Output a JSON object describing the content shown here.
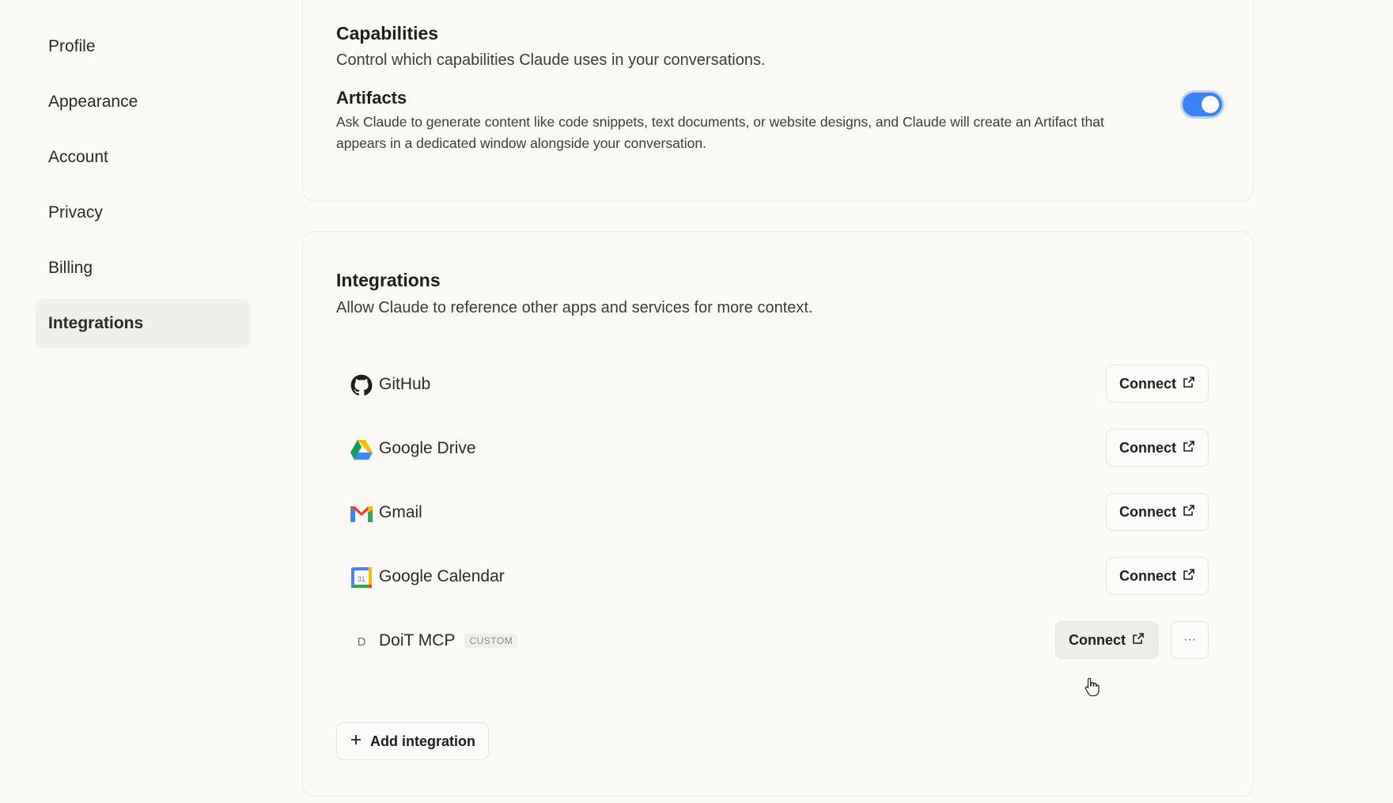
{
  "sidebar": {
    "items": [
      {
        "label": "Profile"
      },
      {
        "label": "Appearance"
      },
      {
        "label": "Account"
      },
      {
        "label": "Privacy"
      },
      {
        "label": "Billing"
      },
      {
        "label": "Integrations",
        "active": true
      }
    ]
  },
  "capabilities": {
    "title": "Capabilities",
    "description": "Control which capabilities Claude uses in your conversations.",
    "artifacts": {
      "title": "Artifacts",
      "description": "Ask Claude to generate content like code snippets, text documents, or website designs, and Claude will create an Artifact that appears in a dedicated window alongside your conversation.",
      "enabled": true
    }
  },
  "integrations": {
    "title": "Integrations",
    "description": "Allow Claude to reference other apps and services for more context.",
    "items": [
      {
        "name": "GitHub",
        "icon": "github-icon",
        "button": "Connect"
      },
      {
        "name": "Google Drive",
        "icon": "google-drive-icon",
        "button": "Connect"
      },
      {
        "name": "Gmail",
        "icon": "gmail-icon",
        "button": "Connect"
      },
      {
        "name": "Google Calendar",
        "icon": "google-calendar-icon",
        "button": "Connect"
      },
      {
        "name": "DoiT MCP",
        "icon": "letter-d-icon",
        "icon_letter": "D",
        "badge": "CUSTOM",
        "button": "Connect",
        "more": "···"
      }
    ],
    "add_label": "Add integration"
  },
  "colors": {
    "accent": "#3b82f6",
    "background": "#faf9f6"
  }
}
